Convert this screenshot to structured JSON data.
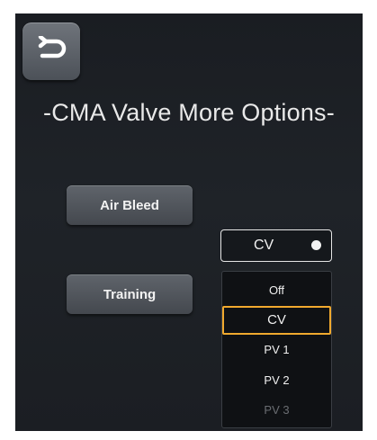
{
  "screen": {
    "title": "-CMA Valve More Options-"
  },
  "navigation": {
    "back_icon": "undo-arrow-icon"
  },
  "buttons": {
    "air_bleed": "Air Bleed",
    "training": "Training"
  },
  "mode_select": {
    "selected": "CV",
    "options": [
      "Off",
      "CV",
      "PV 1",
      "PV 2",
      "PV 3"
    ],
    "highlighted_option": "CV",
    "highlight_color": "#f0a92e"
  }
}
